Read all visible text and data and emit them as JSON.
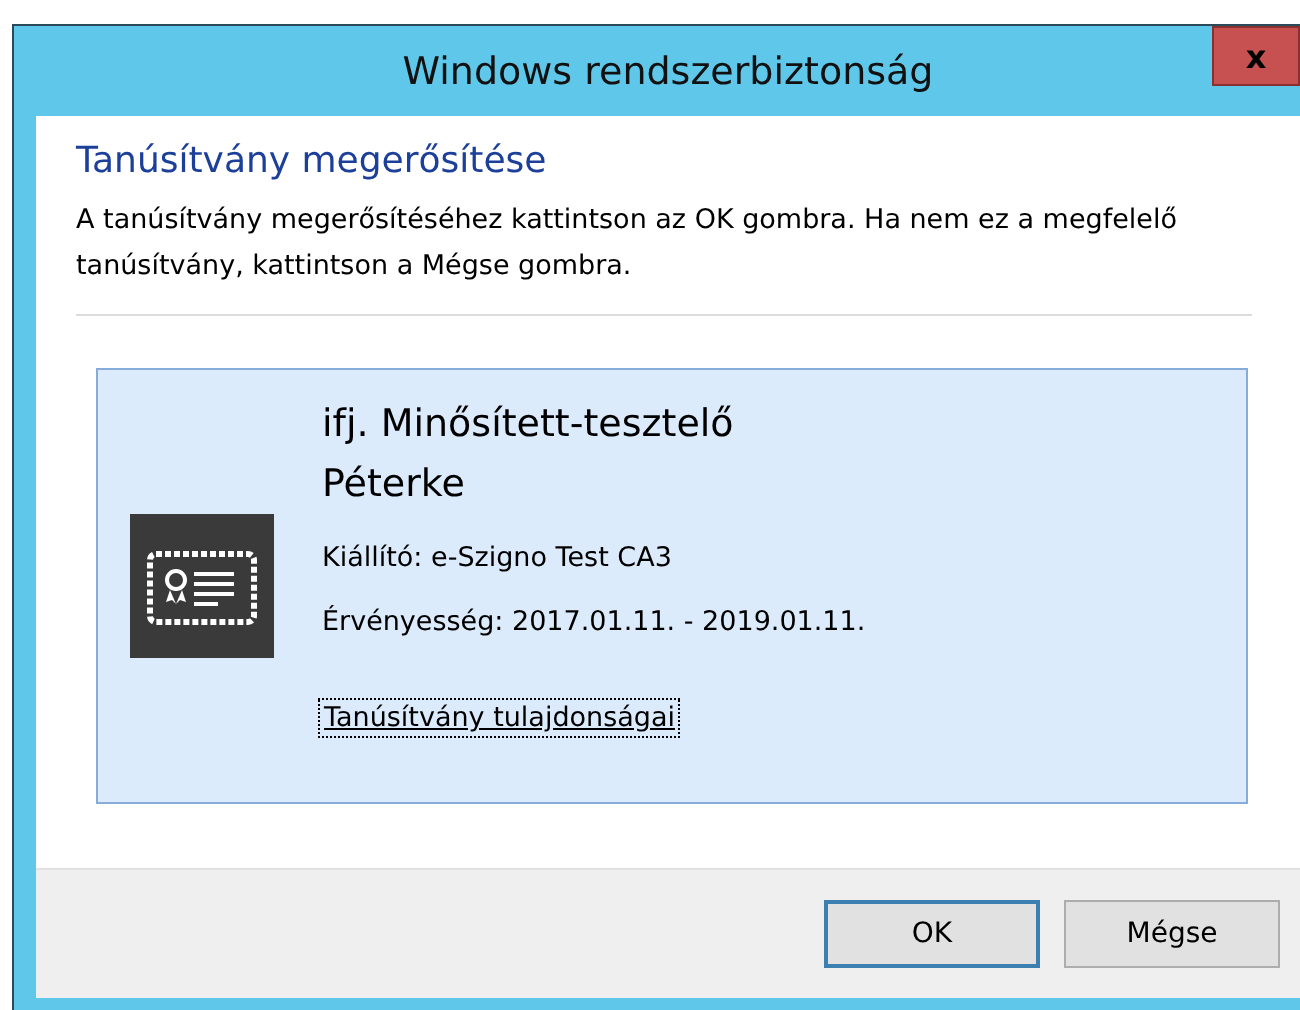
{
  "window": {
    "title": "Windows rendszerbiztonság",
    "close": "x"
  },
  "heading": "Tanúsítvány megerősítése",
  "description": "A tanúsítvány megerősítéséhez kattintson az OK gombra. Ha nem ez a megfelelő tanúsítvány, kattintson a Mégse gombra.",
  "certificate": {
    "name_lines": [
      "ifj. Minősített-tesztelő",
      "Péterke"
    ],
    "issuer": "Kiállító: e-Szigno Test CA3",
    "validity": "Érvényesség: 2017.01.11. - 2019.01.11.",
    "properties_link": "Tanúsítvány tulajdonságai"
  },
  "buttons": [
    {
      "label": "OK",
      "kind": "default"
    },
    {
      "label": "Mégse",
      "kind": "normal"
    }
  ]
}
